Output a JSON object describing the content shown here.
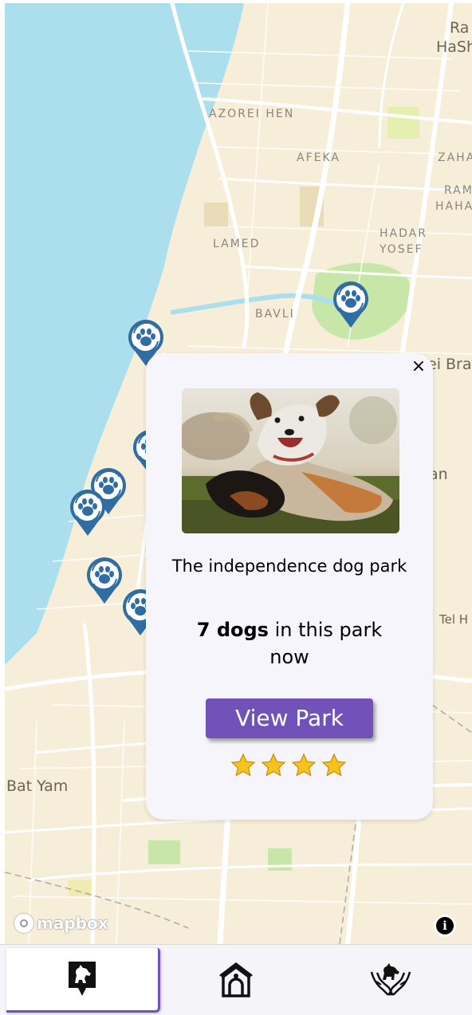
{
  "map": {
    "districts": [
      "AZOREI HEN",
      "AFEKA",
      "LAMED",
      "HADAR",
      "YOSEF",
      "BAVLI",
      "ZAHA",
      "RAM",
      "HAHA"
    ],
    "cities": [
      "Ra",
      "HaSh",
      "ei Bra",
      "an",
      "Tel H",
      "Bat Yam"
    ],
    "attribution": "mapbox",
    "info_label": "i",
    "marker_icon": "dog-park-paw-pin-icon",
    "colors": {
      "sea": "#acdfee",
      "land": "#f6eed8",
      "park": "#c8e6a8",
      "road": "#ffffff",
      "marker": "#2f6da3"
    }
  },
  "popup": {
    "close_label": "×",
    "park_name": "The independence dog park",
    "dog_count": "7 dogs",
    "dogs_suffix": " in this park now",
    "view_button": "View Park",
    "rating": 4,
    "max_rating": 4,
    "button_color": "#7152b8"
  },
  "tabs": [
    {
      "name": "map",
      "icon": "dog-location-pin-icon",
      "active": true
    },
    {
      "name": "dog-house",
      "icon": "dog-house-icon",
      "active": false
    },
    {
      "name": "dog-care",
      "icon": "hands-holding-dog-icon",
      "active": false
    }
  ]
}
